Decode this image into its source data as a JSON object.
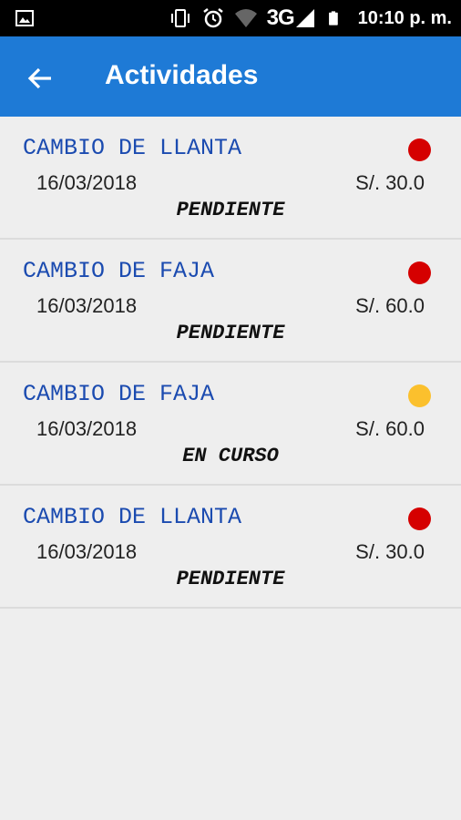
{
  "status_bar": {
    "network": "3G",
    "time": "10:10 p. m."
  },
  "app_bar": {
    "title": "Actividades"
  },
  "colors": {
    "app_bar": "#1e7ad6",
    "title_text": "#1b4bb0",
    "status_red": "#d50000",
    "status_yellow": "#fbc02d"
  },
  "items": [
    {
      "title": "CAMBIO DE LLANTA",
      "date": "16/03/2018",
      "price": "S/. 30.0",
      "status": "PENDIENTE",
      "indicator": "red"
    },
    {
      "title": "CAMBIO DE FAJA",
      "date": "16/03/2018",
      "price": "S/. 60.0",
      "status": "PENDIENTE",
      "indicator": "red"
    },
    {
      "title": "CAMBIO DE FAJA",
      "date": "16/03/2018",
      "price": "S/. 60.0",
      "status": "EN CURSO",
      "indicator": "yellow"
    },
    {
      "title": "CAMBIO DE LLANTA",
      "date": "16/03/2018",
      "price": "S/. 30.0",
      "status": "PENDIENTE",
      "indicator": "red"
    }
  ]
}
